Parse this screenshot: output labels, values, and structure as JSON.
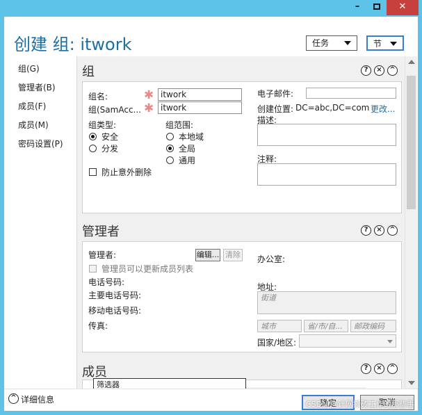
{
  "window": {
    "min": "–",
    "close": "✕"
  },
  "header": {
    "title": "创建 组: itwork",
    "tasks": "任务",
    "section": "节"
  },
  "nav": [
    "组(G)",
    "管理者(B)",
    "成员(F)",
    "成员(M)",
    "密码设置(P)"
  ],
  "group": {
    "title": "组",
    "name_label": "组名:",
    "name_value": "itwork",
    "sam_label": "组(SamAcc...",
    "sam_value": "itwork",
    "type_label": "组类型:",
    "type_security": "安全",
    "type_distribution": "分发",
    "scope_label": "组范围:",
    "scope_local": "本地域",
    "scope_global": "全局",
    "scope_universal": "通用",
    "protect": "防止意外删除",
    "email_label": "电子邮件:",
    "location_label": "创建位置:",
    "location_value": "DC=abc,DC=com",
    "change_link": "更改...",
    "desc_label": "描述:",
    "notes_label": "注释:"
  },
  "managedby": {
    "title": "管理者",
    "manager_label": "管理者:",
    "edit_btn": "编辑...",
    "clear_btn": "清除",
    "can_update": "管理员可以更新成员列表",
    "phone": "电话号码:",
    "main_phone": "主要电话号码:",
    "mobile": "移动电话号码:",
    "fax": "传真:",
    "office": "办公室:",
    "address": "地址:",
    "street": "街道",
    "city": "城市",
    "state": "省/市/自...",
    "zip": "邮政编码",
    "country": "国家/地区:"
  },
  "members": {
    "title": "成员",
    "filter": "筛选器"
  },
  "icons": {
    "help": "?",
    "close": "×",
    "collapse": "^"
  },
  "footer": {
    "details": "详细信息",
    "ok": "确定",
    "cancel": "取消"
  },
  "watermark": "CSDN @计网搬砖工作的那些事"
}
